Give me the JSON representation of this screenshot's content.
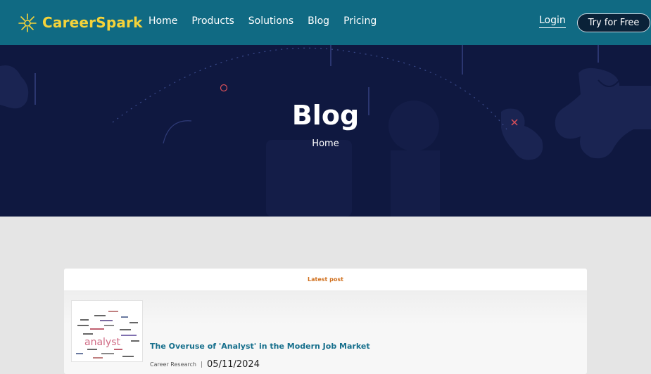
{
  "brand": {
    "name": "CareerSpark",
    "accent": "#f5d33a",
    "header_bg": "#106a83"
  },
  "nav": {
    "items": [
      {
        "label": "Home"
      },
      {
        "label": "Products"
      },
      {
        "label": "Solutions"
      },
      {
        "label": "Blog"
      },
      {
        "label": "Pricing"
      }
    ],
    "login_label": "Login",
    "cta_label": "Try for Free"
  },
  "hero": {
    "title": "Blog",
    "breadcrumb": "Home",
    "bg": "#0f1840"
  },
  "latest": {
    "section_label": "Latest post",
    "post": {
      "title": "The Overuse of 'Analyst' in the Modern Job Market",
      "category": "Career Research",
      "date": "05/11/2024",
      "thumbnail_icon": "word-cloud-analyst"
    }
  }
}
